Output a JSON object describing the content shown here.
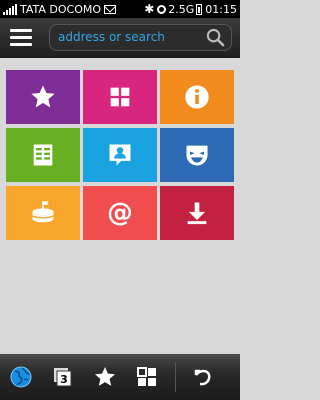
{
  "status_bar": {
    "operator": "TATA DOCOMO",
    "network": "2.5G",
    "time": "01:15",
    "icons": [
      "signal-icon",
      "mail-icon",
      "bluetooth-icon",
      "sync-icon",
      "battery-icon"
    ]
  },
  "toolbar": {
    "menu_icon": "menu-icon",
    "address_placeholder": "address or search",
    "search_icon": "search-icon"
  },
  "tiles": [
    {
      "name": "bookmarks",
      "icon": "star-icon",
      "color": "#7d2d96"
    },
    {
      "name": "windows",
      "icon": "grid-icon",
      "color": "#d6267e"
    },
    {
      "name": "info",
      "icon": "info-icon",
      "color": "#f28b1e"
    },
    {
      "name": "feeds",
      "icon": "document-icon",
      "color": "#68b023"
    },
    {
      "name": "contacts",
      "icon": "contact-card-icon",
      "color": "#1aa3e0"
    },
    {
      "name": "entertainment",
      "icon": "mask-icon",
      "color": "#2d6ab3"
    },
    {
      "name": "events",
      "icon": "cake-icon",
      "color": "#f8a52b"
    },
    {
      "name": "email",
      "icon": "at-icon",
      "color": "#f04e4e"
    },
    {
      "name": "downloads",
      "icon": "download-icon",
      "color": "#c2213f"
    }
  ],
  "bottom_bar": {
    "buttons": [
      "globe-icon",
      "windows-icon",
      "bookmarks-icon",
      "apps-icon",
      "back-icon"
    ],
    "window_count": "3"
  },
  "colors": {
    "background": "#d8d8d8",
    "accent": "#33a4e6"
  }
}
